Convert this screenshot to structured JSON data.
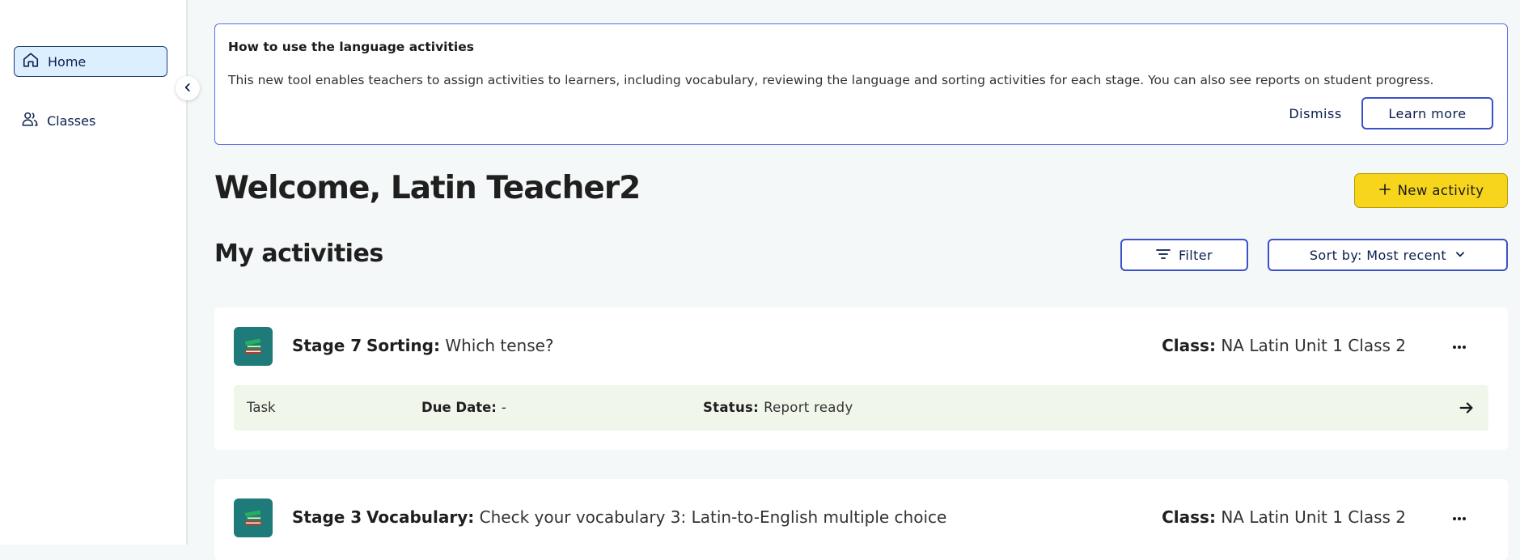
{
  "sidebar": {
    "items": [
      {
        "label": "Home",
        "icon": "home-icon",
        "active": true
      },
      {
        "label": "Classes",
        "icon": "users-icon",
        "active": false
      }
    ]
  },
  "banner": {
    "title": "How to use the language activities",
    "text": "This new tool enables teachers to assign activities to learners, including vocabulary, reviewing the language and sorting activities for each stage. You can also see reports on student progress.",
    "dismiss_label": "Dismiss",
    "learn_more_label": "Learn more"
  },
  "header": {
    "welcome": "Welcome, Latin Teacher2",
    "new_activity_label": "New activity"
  },
  "activities_section": {
    "title": "My activities",
    "filter_label": "Filter",
    "sort_label": "Sort by: Most recent"
  },
  "activities": [
    {
      "stage": "Stage 7",
      "type": "Sorting:",
      "name": "Which tense?",
      "class_label": "Class:",
      "class_name": "NA Latin Unit 1 Class 2",
      "row": {
        "task": "Task",
        "due_label": "Due Date:",
        "due_value": "-",
        "status_label": "Status:",
        "status_value": "Report ready"
      }
    },
    {
      "stage": "Stage 3",
      "type": "Vocabulary:",
      "name": "Check your vocabulary 3: Latin-to-English multiple choice",
      "class_label": "Class:",
      "class_name": "NA Latin Unit 1 Class 2"
    }
  ],
  "colors": {
    "accent": "#3b51c9",
    "new_activity": "#f7d51d",
    "icon_bg": "#1f7a7a",
    "row_bg": "#f0f6ea"
  }
}
